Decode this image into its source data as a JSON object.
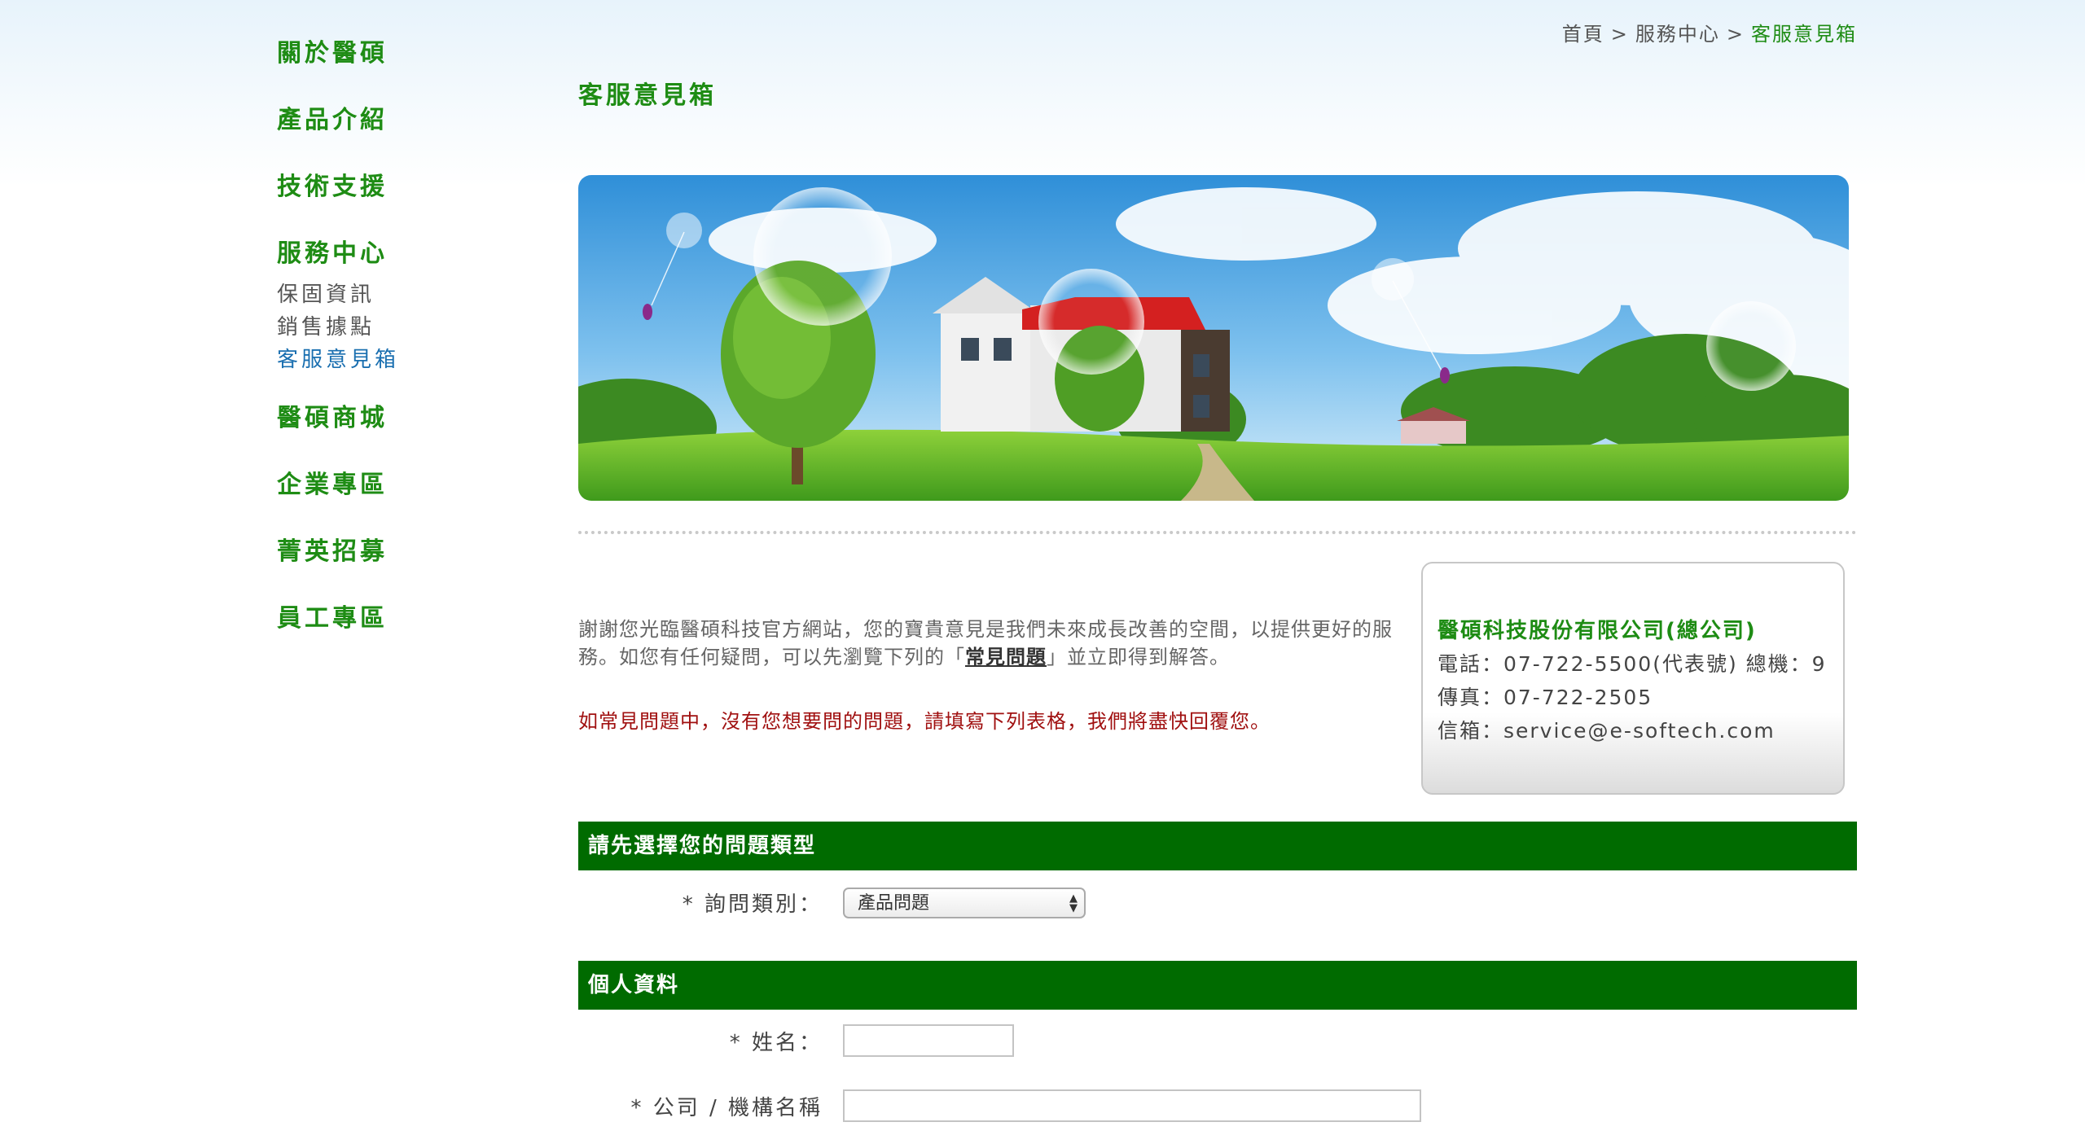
{
  "nav": {
    "items": [
      {
        "label": "關於醫碩"
      },
      {
        "label": "產品介紹"
      },
      {
        "label": "技術支援"
      },
      {
        "label": "服務中心"
      },
      {
        "label": "醫碩商城"
      },
      {
        "label": "企業專區"
      },
      {
        "label": "菁英招募"
      },
      {
        "label": "員工專區"
      }
    ],
    "service_sub": [
      {
        "label": "保固資訊"
      },
      {
        "label": "銷售據點"
      },
      {
        "label": "客服意見箱"
      }
    ]
  },
  "breadcrumb": {
    "home": "首頁",
    "parent": "服務中心",
    "current": "客服意見箱",
    "separator": ">"
  },
  "page_title": "客服意見箱",
  "intro": {
    "text_before": "謝謝您光臨醫碩科技官方網站，您的寶貴意見是我們未來成長改善的空間，以提供更好的服務。如您有任何疑問，可以先瀏覽下列的「",
    "faq_link": "常見問題",
    "text_after": "」並立即得到解答。",
    "notice": "如常見問題中，沒有您想要問的問題，請填寫下列表格，我們將盡快回覆您。"
  },
  "contact": {
    "company": "醫碩科技股份有限公司(總公司)",
    "phone": "電話：07-722-5500(代表號) 總機：9",
    "fax": "傳真：07-722-2505",
    "email": "信箱：service@e-softech.com"
  },
  "form": {
    "section_type": "請先選擇您的問題類型",
    "category_label": "* 詢問類別：",
    "category_value": "產品問題",
    "section_personal": "個人資料",
    "name_label": "* 姓名：",
    "name_value": "",
    "company_label": "* 公司 / 機構名稱",
    "company_value": ""
  },
  "colors": {
    "nav_green": "#1e8c14",
    "section_bar": "#006b00",
    "notice_red": "#a01010",
    "active_sub": "#1a6fb0"
  }
}
